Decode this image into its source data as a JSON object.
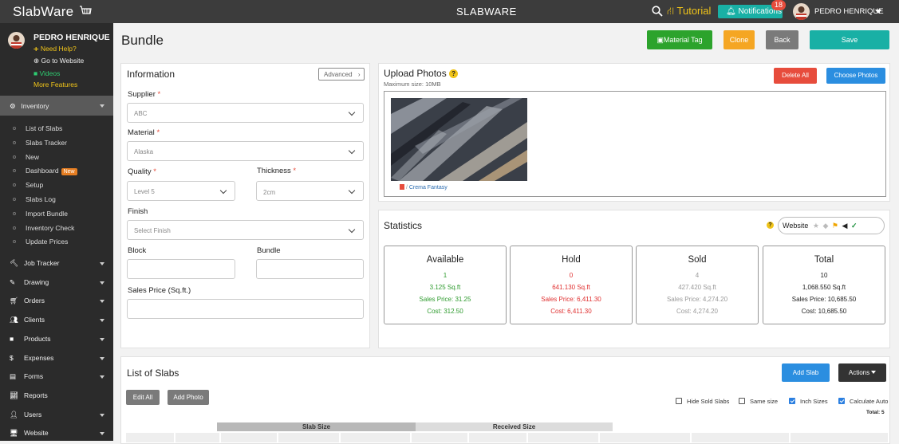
{
  "topbar": {
    "logo_main": "Slab",
    "logo_accent": "Ware",
    "app_title": "SLABWARE",
    "tutorial_label": "Tutorial",
    "notifications_label": "Notifications",
    "notifications_count": "18",
    "user_name": "PEDRO HENRIQUE"
  },
  "sidebar": {
    "user_name": "PEDRO HENRIQUE",
    "need_help": "Need Help?",
    "go_website": "Go to Website",
    "videos": "Videos",
    "more_features": "More Features",
    "inventory_label": "Inventory",
    "inventory_items": [
      {
        "label": "List of Slabs"
      },
      {
        "label": "Slabs Tracker"
      },
      {
        "label": "New"
      },
      {
        "label": "Dashboard",
        "tag": "New"
      },
      {
        "label": "Setup"
      },
      {
        "label": "Slabs Log"
      },
      {
        "label": "Import Bundle"
      },
      {
        "label": "Inventory Check"
      },
      {
        "label": "Update Prices"
      }
    ],
    "main_items": [
      {
        "label": "Job Tracker",
        "icon": "hammer-icon"
      },
      {
        "label": "Drawing",
        "icon": "pencil-icon"
      },
      {
        "label": "Orders",
        "icon": "cart-icon"
      },
      {
        "label": "Clients",
        "icon": "users-icon"
      },
      {
        "label": "Products",
        "icon": "box-icon"
      },
      {
        "label": "Expenses",
        "icon": "dollar-icon"
      },
      {
        "label": "Forms",
        "icon": "form-icon"
      },
      {
        "label": "Reports",
        "icon": "chart-icon"
      },
      {
        "label": "Users",
        "icon": "user-icon"
      },
      {
        "label": "Website",
        "icon": "monitor-icon"
      }
    ]
  },
  "page": {
    "title": "Bundle",
    "buttons": {
      "material_tag": "Material Tag",
      "clone": "Clone",
      "back": "Back",
      "save": "Save"
    }
  },
  "information": {
    "heading": "Information",
    "advanced_label": "Advanced",
    "supplier_label": "Supplier",
    "supplier_value": "ABC",
    "material_label": "Material",
    "material_value": "Alaska",
    "quality_label": "Quality",
    "quality_value": "Level 5",
    "thickness_label": "Thickness",
    "thickness_value": "2cm",
    "finish_label": "Finish",
    "finish_placeholder": "Select Finish",
    "block_label": "Block",
    "bundle_label": "Bundle",
    "sales_price_label": "Sales Price (Sq.ft.)"
  },
  "upload": {
    "heading": "Upload Photos",
    "max_size": "Maximum size: 10MB",
    "delete_all": "Delete All",
    "choose_photos": "Choose Photos",
    "photo_caption": "Crema Fantasy"
  },
  "statistics": {
    "heading": "Statistics",
    "website_label": "Website",
    "cards": [
      {
        "title": "Available",
        "count": "1",
        "sqft": "3.125 Sq.ft",
        "sales": "Sales Price: 31.25",
        "cost": "Cost: 312.50",
        "color": "#2e9b2e"
      },
      {
        "title": "Hold",
        "count": "0",
        "sqft": "641.130 Sq.ft",
        "sales": "Sales Price: 6,411.30",
        "cost": "Cost: 6,411.30",
        "color": "#e03030"
      },
      {
        "title": "Sold",
        "count": "4",
        "sqft": "427.420 Sq.ft",
        "sales": "Sales Price: 4,274.20",
        "cost": "Cost: 4,274.20",
        "color": "#999999"
      },
      {
        "title": "Total",
        "count": "10",
        "sqft": "1,068.550 Sq.ft",
        "sales": "Sales Price: 10,685.50",
        "cost": "Cost: 10,685.50",
        "color": "#222222"
      }
    ]
  },
  "slabs": {
    "heading": "List of Slabs",
    "add_slab": "Add Slab",
    "actions": "Actions",
    "edit_all": "Edit All",
    "add_photo": "Add Photo",
    "hide_sold": "Hide Sold Slabs",
    "same_size": "Same size",
    "inch_sizes": "Inch Sizes",
    "calculate_auto": "Calculate Auto",
    "total": "Total: 5",
    "slab_size_header": "Slab Size",
    "received_size_header": "Received Size",
    "checks": {
      "hide_sold": false,
      "same_size": false,
      "inch_sizes": true,
      "calculate_auto": true
    }
  }
}
